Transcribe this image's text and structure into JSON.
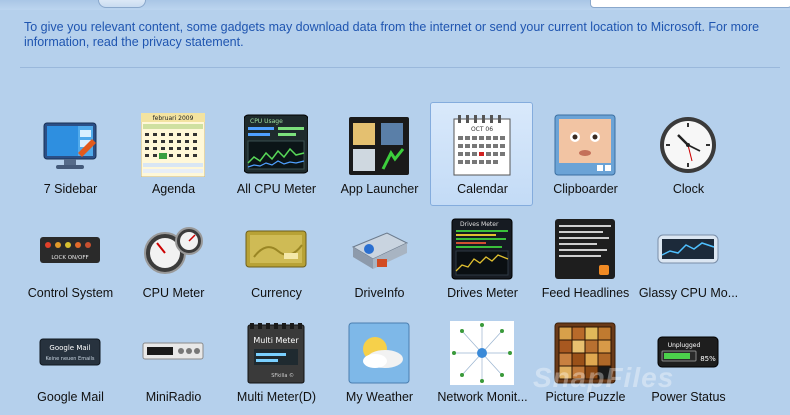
{
  "info_text": "To give you relevant content, some gadgets may download data from the internet or send your current location to Microsoft. For more information, read the privacy statement.",
  "colors": {
    "info_text": "#1f55b0",
    "background": "#b5d0ec",
    "selected_tile": "#c3dbf6"
  },
  "gadgets": [
    {
      "label": "7 Sidebar",
      "icon": "monitor-icon"
    },
    {
      "label": "Agenda",
      "icon": "agenda-calendar-icon"
    },
    {
      "label": "All CPU Meter",
      "icon": "cpu-graph-icon"
    },
    {
      "label": "App Launcher",
      "icon": "app-launcher-icon"
    },
    {
      "label": "Calendar",
      "icon": "calendar-icon",
      "selected": true
    },
    {
      "label": "Clipboarder",
      "icon": "baby-photo-icon"
    },
    {
      "label": "Clock",
      "icon": "clock-icon"
    },
    {
      "label": "Control System",
      "icon": "control-system-icon"
    },
    {
      "label": "CPU Meter",
      "icon": "cpu-gauge-icon"
    },
    {
      "label": "Currency",
      "icon": "currency-card-icon"
    },
    {
      "label": "DriveInfo",
      "icon": "hard-drive-icon"
    },
    {
      "label": "Drives Meter",
      "icon": "drives-meter-icon"
    },
    {
      "label": "Feed Headlines",
      "icon": "feed-headlines-icon"
    },
    {
      "label": "Glassy CPU Mo...",
      "icon": "glassy-cpu-icon"
    },
    {
      "label": "Google Mail",
      "icon": "google-mail-icon"
    },
    {
      "label": "MiniRadio",
      "icon": "mini-radio-icon"
    },
    {
      "label": "Multi Meter(D)",
      "icon": "multi-meter-icon"
    },
    {
      "label": "My Weather",
      "icon": "weather-icon"
    },
    {
      "label": "Network Monit...",
      "icon": "network-monitor-icon"
    },
    {
      "label": "Picture Puzzle",
      "icon": "picture-puzzle-icon"
    },
    {
      "label": "Power Status",
      "icon": "power-status-icon"
    }
  ],
  "thumb_text": {
    "agenda_month": "februari 2009",
    "calendar_month": "OCT 06",
    "control_system": "LOCK ON/OFF",
    "google_mail_title": "Google Mail",
    "google_mail_sub": "Keine neuen Emails",
    "multi_meter": "Multi Meter",
    "multi_meter_brand": "SFkilla ©",
    "drives_meter": "Drives Meter",
    "cpu_usage": "CPU Usage",
    "power_status": "Unplugged",
    "power_percent": "85%"
  },
  "watermark": "SnapFiles"
}
